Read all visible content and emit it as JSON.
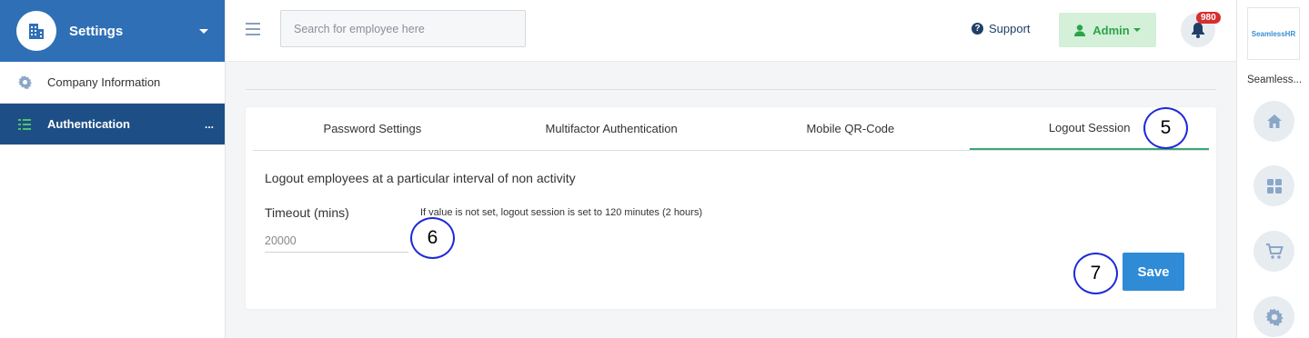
{
  "sidebar": {
    "title": "Settings",
    "items": [
      {
        "label": "Company Information"
      },
      {
        "label": "Authentication",
        "more": "..."
      }
    ]
  },
  "topbar": {
    "search_placeholder": "Search for employee here",
    "support_label": "Support",
    "admin_label": "Admin",
    "notification_count": "980"
  },
  "rail": {
    "logo_text": "SeamlessHR",
    "company_name": "Seamless..."
  },
  "tabs": [
    {
      "label": "Password Settings"
    },
    {
      "label": "Multifactor Authentication"
    },
    {
      "label": "Mobile QR-Code"
    },
    {
      "label": "Logout Session",
      "active": true
    }
  ],
  "logout": {
    "description": "Logout employees at a particular interval of non activity",
    "timeout_label": "Timeout (mins)",
    "hint": "If value is not set, logout session is set to 120 minutes (2 hours)",
    "timeout_value": "20000",
    "save_label": "Save"
  },
  "callouts": [
    "5",
    "6",
    "7"
  ],
  "colors": {
    "primary": "#2f6fb6",
    "sidebar_active": "#1d4f86",
    "save": "#2f8bd6",
    "admin_bg": "#d4f0d8",
    "admin_text": "#2aa44a",
    "tab_active": "#3aa873",
    "badge": "#d62f2f",
    "callout": "#1d2bd6"
  }
}
